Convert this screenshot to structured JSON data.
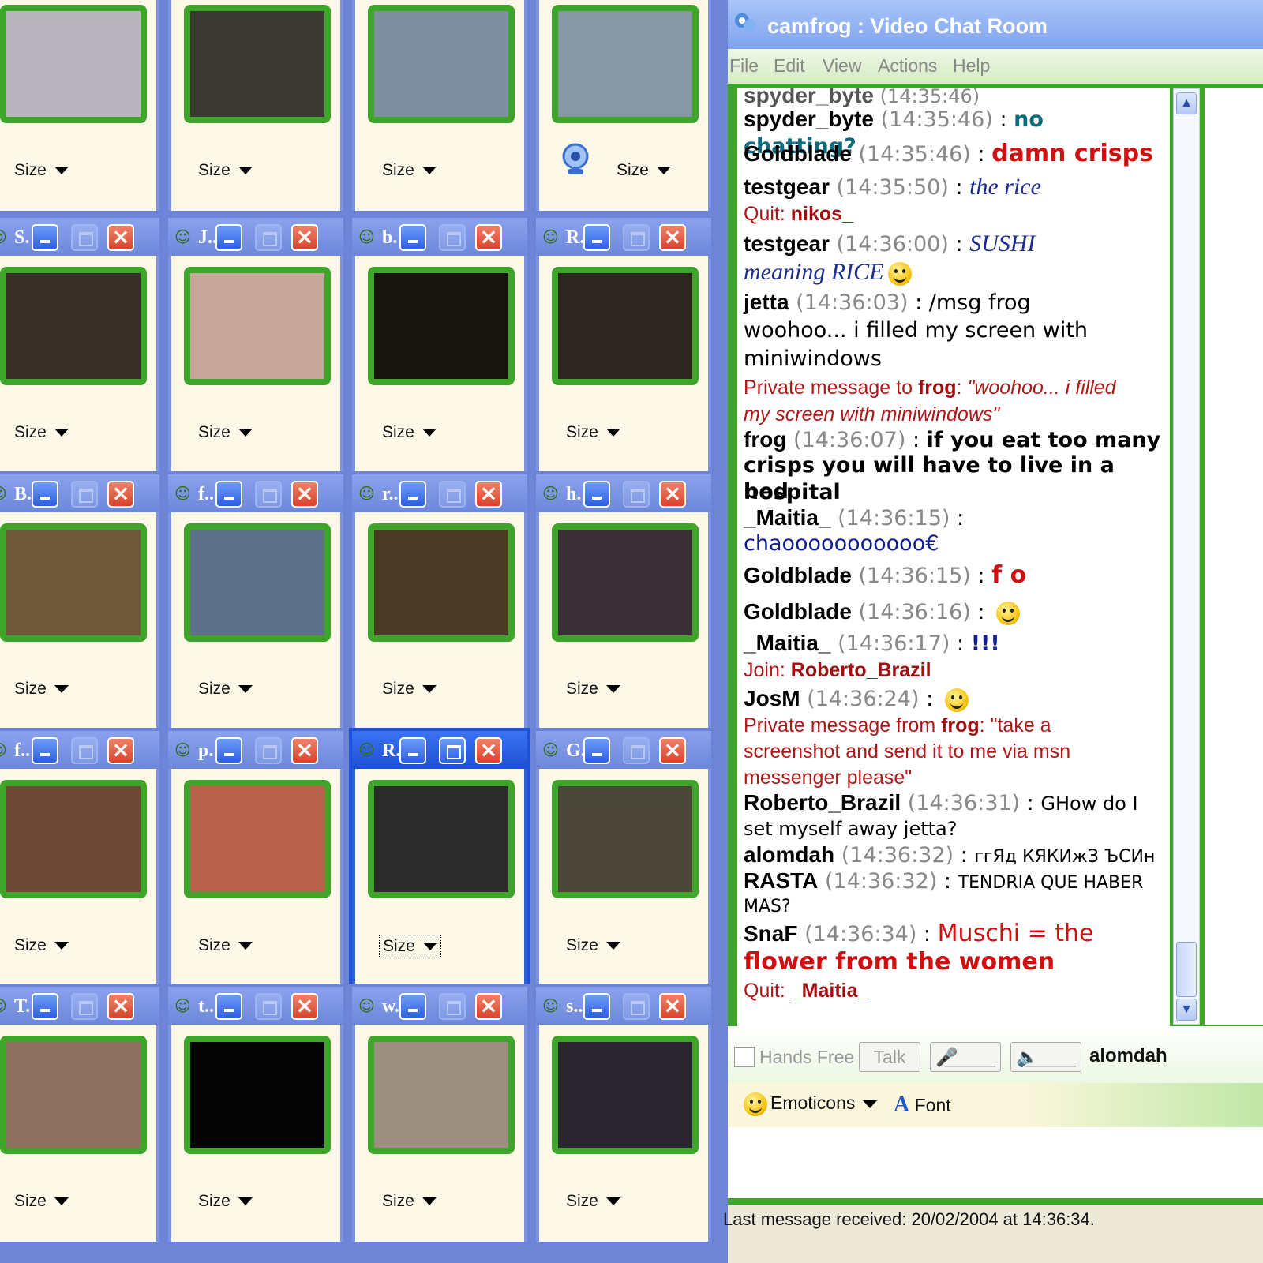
{
  "colors": {
    "titlebar_blue": "#7b93e0",
    "video_frame_green": "#3ea52a",
    "chat_bg_green": "#3ea52a",
    "panel_cream": "#fdf8e8"
  },
  "cam_windows": [
    {
      "name": "",
      "size_label": "Size"
    },
    {
      "name": "",
      "size_label": "Size"
    },
    {
      "name": "",
      "size_label": "Size"
    },
    {
      "name": "",
      "size_label": "Size"
    },
    {
      "name": "S.",
      "size_label": "Size"
    },
    {
      "name": "J..",
      "size_label": "Size"
    },
    {
      "name": "b.",
      "size_label": "Size"
    },
    {
      "name": "R.",
      "size_label": "Size"
    },
    {
      "name": "B.",
      "size_label": "Size"
    },
    {
      "name": "f..",
      "size_label": "Size"
    },
    {
      "name": "r..",
      "size_label": "Size"
    },
    {
      "name": "h.",
      "size_label": "Size"
    },
    {
      "name": "f..",
      "size_label": "Size"
    },
    {
      "name": "p.",
      "size_label": "Size"
    },
    {
      "name": "R.",
      "size_label": "Size"
    },
    {
      "name": "G.",
      "size_label": "Size"
    },
    {
      "name": "T.",
      "size_label": "Size"
    },
    {
      "name": "t..",
      "size_label": "Size"
    },
    {
      "name": "w.",
      "size_label": "Size"
    },
    {
      "name": "s..",
      "size_label": "Size"
    }
  ],
  "chat": {
    "title": "camfrog : Video Chat Room",
    "menu": [
      "File",
      "Edit",
      "View",
      "Actions",
      "Help"
    ],
    "messages": [
      {
        "nick": "spyder_byte",
        "time": "(14:35:46)",
        "text": "no chatting?"
      },
      {
        "nick": "Goldblade",
        "time": "(14:35:46)",
        "text": "damn crisps"
      },
      {
        "nick": "testgear",
        "time": "(14:35:50)",
        "text": "the rice"
      },
      {
        "prefix": "Quit:",
        "nick": "nikos_"
      },
      {
        "nick": "testgear",
        "time": "(14:36:00)",
        "text": "SUSHI",
        "text2": "meaning RICE"
      },
      {
        "nick": "jetta",
        "time": "(14:36:03)",
        "text": "/msg frog",
        "text2": "woohoo... i filled my screen with",
        "text3": "miniwindows"
      },
      {
        "prefix": "Private message to",
        "nick": "frog",
        "text": "\"woohoo... i filled",
        "text2": "my screen with miniwindows\""
      },
      {
        "nick": "frog",
        "time": "(14:36:07)",
        "text": "if you eat too many",
        "text2": "crisps you will have to live in a hospital",
        "text3": "bed"
      },
      {
        "nick": "_Maitia_",
        "time": "(14:36:15)",
        "text2": "chaooooooooooo€"
      },
      {
        "nick": "Goldblade",
        "time": "(14:36:15)",
        "text": "f o"
      },
      {
        "nick": "Goldblade",
        "time": "(14:36:16)"
      },
      {
        "nick": "_Maitia_",
        "time": "(14:36:17)",
        "text": "!!!"
      },
      {
        "prefix": "Join:",
        "nick": "Roberto_Brazil"
      },
      {
        "nick": "JosM",
        "time": "(14:36:24)"
      },
      {
        "prefix": "Private message from",
        "nick": "frog",
        "text": "\"take a",
        "text2": "screenshot and send it to me via msn",
        "text3": "messenger please\""
      },
      {
        "nick": "Roberto_Brazil",
        "time": "(14:36:31)",
        "text": "GHow do I",
        "text2": "set myself away jetta?"
      },
      {
        "nick": "alomdah",
        "time": "(14:36:32)",
        "text": "ггЯд КЯКИжЗ ЪСИн"
      },
      {
        "nick": "RASTA",
        "time": "(14:36:32)",
        "text": "TENDRIA QUE HABER",
        "text2": "MAS?"
      },
      {
        "nick": "SnaF",
        "time": "(14:36:34)",
        "text": "Muschi = the",
        "text2": "flower from the women"
      },
      {
        "prefix": "Quit:",
        "nick": "_Maitia_"
      }
    ],
    "hands_free_label": "Hands Free",
    "talk_label": "Talk",
    "mic_label": "_____",
    "speaker_label": "_____",
    "current_user": "alomdah",
    "emoticons_label": "Emoticons",
    "font_label": "Font",
    "status": "Last message received: 20/02/2004 at 14:36:34."
  }
}
